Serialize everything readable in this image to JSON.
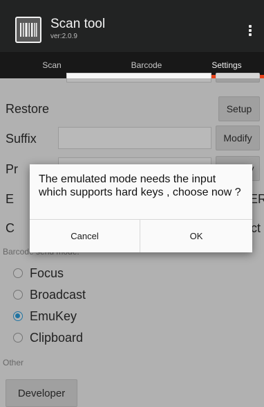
{
  "app": {
    "title": "Scan tool",
    "version": "ver:2.0.9",
    "icon": "barcode-app-icon",
    "menu_icon": "more-vert-icon"
  },
  "tabs": [
    {
      "label": "Scan",
      "active": false
    },
    {
      "label": "Barcode",
      "active": false
    },
    {
      "label": "Settings",
      "active": true
    }
  ],
  "settings": {
    "restore": {
      "label": "Restore",
      "button": "Setup"
    },
    "suffix": {
      "label": "Suffix",
      "value": "",
      "button": "Modify"
    },
    "prefix": {
      "label_partial": "Pr",
      "button_partial": "y"
    },
    "emulator": {
      "label_partial": "E",
      "right_partial": "ER"
    },
    "clip": {
      "label_partial": "C",
      "right_partial": "ct"
    },
    "output_section_label": "Barcode send mode:",
    "output_modes": [
      {
        "label": "Focus",
        "checked": false
      },
      {
        "label": "Broadcast",
        "checked": false
      },
      {
        "label": "EmuKey",
        "checked": true
      },
      {
        "label": "Clipboard",
        "checked": false
      }
    ],
    "other_section_label": "Other",
    "developer_button": "Developer"
  },
  "dialog": {
    "message": "The emulated mode needs the input which supports hard keys , choose now ?",
    "cancel": "Cancel",
    "ok": "OK"
  },
  "colors": {
    "appbar": "#222323",
    "tabbar": "#181818",
    "tab_indicator": "#e8421a",
    "radio_checked": "#2b9bd9",
    "background": "#ececec"
  }
}
